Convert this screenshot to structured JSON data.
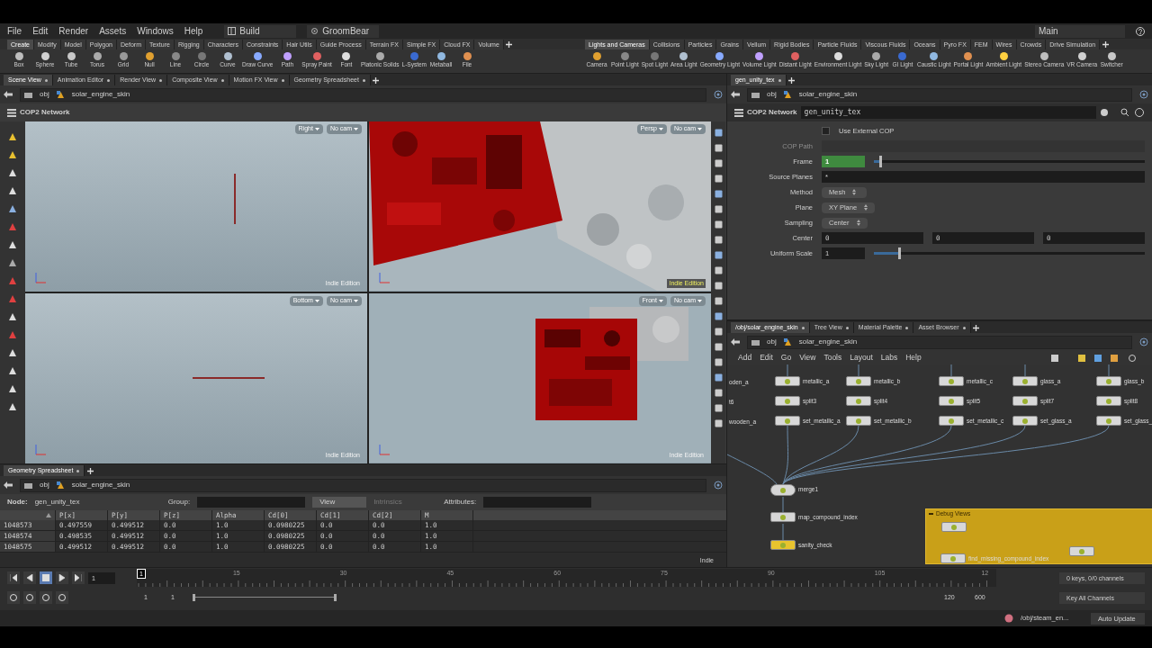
{
  "menu_bar": {
    "menus": [
      "File",
      "Edit",
      "Render",
      "Assets",
      "Windows",
      "Help"
    ],
    "desktop": "Build",
    "context": "GroomBear",
    "layout": "Main"
  },
  "shelf_left": {
    "tabs": [
      {
        "label": "Create",
        "selected": true
      },
      {
        "label": "Modify",
        "selected": false
      },
      {
        "label": "Model",
        "selected": false
      },
      {
        "label": "Polygon",
        "selected": false
      },
      {
        "label": "Deform",
        "selected": false
      },
      {
        "label": "Texture",
        "selected": false
      },
      {
        "label": "Rigging",
        "selected": false
      },
      {
        "label": "Characters",
        "selected": false
      },
      {
        "label": "Constraints",
        "selected": false
      },
      {
        "label": "Hair Utils",
        "selected": false
      },
      {
        "label": "Guide Process",
        "selected": false
      },
      {
        "label": "Terrain FX",
        "selected": false
      },
      {
        "label": "Simple FX",
        "selected": false
      },
      {
        "label": "Cloud FX",
        "selected": false
      },
      {
        "label": "Volume",
        "selected": false
      }
    ],
    "tools": [
      "Box",
      "Sphere",
      "Tube",
      "Torus",
      "Grid",
      "Null",
      "Line",
      "Circle",
      "Curve",
      "Draw Curve",
      "Path",
      "Spray Paint",
      "Font",
      "Platonic Solids",
      "L-System",
      "Metaball",
      "File"
    ]
  },
  "shelf_right": {
    "tabs": [
      {
        "label": "Lights and Cameras",
        "selected": true
      },
      {
        "label": "Collisions",
        "selected": false
      },
      {
        "label": "Particles",
        "selected": false
      },
      {
        "label": "Grains",
        "selected": false
      },
      {
        "label": "Vellum",
        "selected": false
      },
      {
        "label": "Rigid Bodies",
        "selected": false
      },
      {
        "label": "Particle Fluids",
        "selected": false
      },
      {
        "label": "Viscous Fluids",
        "selected": false
      },
      {
        "label": "Oceans",
        "selected": false
      },
      {
        "label": "Pyro FX",
        "selected": false
      },
      {
        "label": "FEM",
        "selected": false
      },
      {
        "label": "Wires",
        "selected": false
      },
      {
        "label": "Crowds",
        "selected": false
      },
      {
        "label": "Drive Simulation",
        "selected": false
      }
    ],
    "tools": [
      "Camera",
      "Point Light",
      "Spot Light",
      "Area Light",
      "Geometry Light",
      "Volume Light",
      "Distant Light",
      "Environment Light",
      "Sky Light",
      "GI Light",
      "Caustic Light",
      "Portal Light",
      "Ambient Light",
      "Stereo Camera",
      "VR Camera",
      "Switcher"
    ]
  },
  "scene_pane": {
    "tabs": [
      {
        "label": "Scene View",
        "selected": true
      },
      {
        "label": "Animation Editor",
        "selected": false
      },
      {
        "label": "Render View",
        "selected": false
      },
      {
        "label": "Composite View",
        "selected": false
      },
      {
        "label": "Motion FX View",
        "selected": false
      },
      {
        "label": "Geometry Spreadsheet",
        "selected": false
      }
    ],
    "path": [
      "obj",
      "solar_engine_skin"
    ],
    "network_label": "COP2 Network",
    "viewports": [
      {
        "view": "Right",
        "camera": "No cam",
        "watermark": "Indie Edition",
        "kind": "vertical-line"
      },
      {
        "view": "Persp",
        "camera": "No cam",
        "watermark": "Indie Edition",
        "kind": "texture-tilted"
      },
      {
        "view": "Bottom",
        "camera": "No cam",
        "watermark": "Indie Edition",
        "kind": "horizontal-line"
      },
      {
        "view": "Front",
        "camera": "No cam",
        "watermark": "Indie Edition",
        "kind": "texture-square"
      }
    ]
  },
  "spreadsheet": {
    "tabs": [
      {
        "label": "Geometry Spreadsheet",
        "selected": true
      }
    ],
    "path": [
      "obj",
      "solar_engine_skin"
    ],
    "node_label": "Node:",
    "node": "gen_unity_tex",
    "group_label": "Group:",
    "view": "View",
    "intrinsics": "Intrinsics",
    "attributes_label": "Attributes:",
    "columns": [
      "",
      "P[x]",
      "P[y]",
      "P[z]",
      "Alpha",
      "Cd[0]",
      "Cd[1]",
      "Cd[2]",
      "M"
    ],
    "rows": [
      [
        "1048573",
        "0.497559",
        "0.499512",
        "0.0",
        "1.0",
        "0.0980225",
        "0.0",
        "0.0",
        "1.0"
      ],
      [
        "1048574",
        "0.498535",
        "0.499512",
        "0.0",
        "1.0",
        "0.0980225",
        "0.0",
        "0.0",
        "1.0"
      ],
      [
        "1048575",
        "0.499512",
        "0.499512",
        "0.0",
        "1.0",
        "0.0980225",
        "0.0",
        "0.0",
        "1.0"
      ]
    ],
    "edition": "Indie"
  },
  "parameters": {
    "tabs": [
      {
        "label": "gen_unity_tex",
        "selected": true
      }
    ],
    "path": [
      "obj",
      "solar_engine_skin"
    ],
    "type": "COP2 Network",
    "name": "gen_unity_tex",
    "params": [
      {
        "kind": "checkbox",
        "label": "Use External COP",
        "checked": false
      },
      {
        "kind": "text",
        "label": "COP Path",
        "disabled": true
      },
      {
        "kind": "slider",
        "label": "Frame",
        "value": "1",
        "level": 0.02,
        "keyed": true
      },
      {
        "kind": "text",
        "label": "Source Planes",
        "value": "*",
        "disabled": false
      },
      {
        "kind": "menu",
        "label": "Method",
        "value": "Mesh"
      },
      {
        "kind": "menu",
        "label": "Plane",
        "value": "XY Plane"
      },
      {
        "kind": "menu",
        "label": "Sampling",
        "value": "Center"
      },
      {
        "kind": "vector",
        "label": "Center",
        "values": [
          "0",
          "0",
          "0"
        ]
      },
      {
        "kind": "slider",
        "label": "Uniform Scale",
        "value": "1",
        "level": 0.09,
        "keyed": false
      }
    ]
  },
  "network": {
    "tabs": [
      {
        "label": "/obj/solar_engine_skin",
        "selected": true
      },
      {
        "label": "Tree View",
        "selected": false
      },
      {
        "label": "Material Palette",
        "selected": false
      },
      {
        "label": "Asset Browser",
        "selected": false
      }
    ],
    "path": [
      "obj",
      "solar_engine_skin"
    ],
    "menus": [
      "Add",
      "Edit",
      "Go",
      "View",
      "Tools",
      "Layout",
      "Labs",
      "Help"
    ],
    "cut_labels": [
      "oden_a",
      "t6",
      "wooden_a"
    ],
    "columns": [
      {
        "nodes": [
          "metallic_a",
          "split3",
          "set_metallic_a"
        ]
      },
      {
        "nodes": [
          "metallic_b",
          "split4",
          "set_metallic_b"
        ]
      },
      {
        "nodes": [
          "metallic_c",
          "split5",
          "set_metallic_c"
        ]
      },
      {
        "nodes": [
          "glass_a",
          "split7",
          "set_glass_a"
        ]
      },
      {
        "nodes": [
          "glass_b",
          "split8",
          "set_glass_"
        ]
      }
    ],
    "chain": [
      {
        "name": "merge1",
        "color": "#d6d6d6"
      },
      {
        "name": "map_compound_index",
        "color": "#d6d6d6"
      },
      {
        "name": "sanity_check",
        "color": "#e8c32e"
      }
    ],
    "debug_box": {
      "title": "Debug Views",
      "nodes": [
        "find_missing_compound_index"
      ]
    }
  },
  "timeline": {
    "frame": "1",
    "current": "1",
    "ticks": [
      "15",
      "30",
      "45",
      "60",
      "75",
      "90",
      "105",
      "12"
    ],
    "start": "1",
    "start2": "1",
    "end": "120",
    "end2": "600",
    "keys": "0 keys, 0/0 channels",
    "key_all": "Key All Channels",
    "range": {
      "level": 1
    }
  },
  "status_bar": {
    "path": "/obj/steam_en...",
    "update": "Auto Update"
  }
}
